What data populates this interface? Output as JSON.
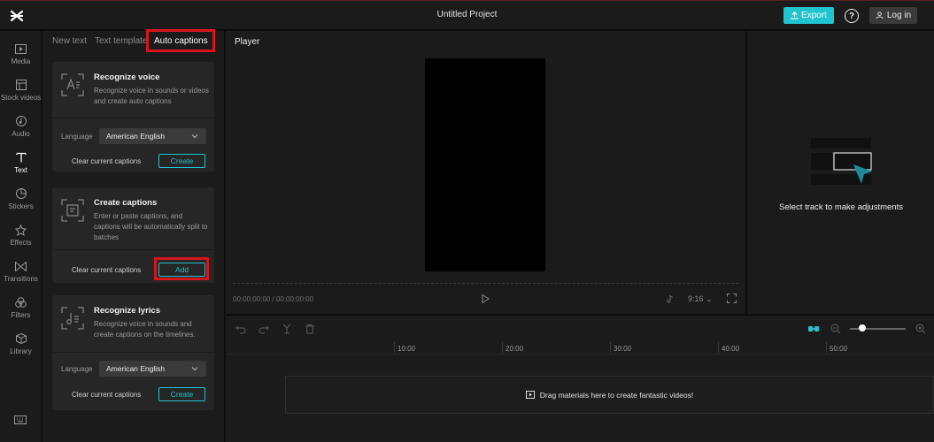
{
  "header": {
    "title": "Untitled Project",
    "export_label": "Export",
    "login_label": "Log in",
    "help_glyph": "?"
  },
  "sidebar": {
    "items": [
      {
        "label": "Media",
        "icon": "media-icon"
      },
      {
        "label": "Stock videos",
        "icon": "stock-videos-icon"
      },
      {
        "label": "Audio",
        "icon": "audio-icon"
      },
      {
        "label": "Text",
        "icon": "text-icon",
        "active": true
      },
      {
        "label": "Stickers",
        "icon": "stickers-icon"
      },
      {
        "label": "Effects",
        "icon": "effects-icon"
      },
      {
        "label": "Transitions",
        "icon": "transitions-icon"
      },
      {
        "label": "Filters",
        "icon": "filters-icon"
      },
      {
        "label": "Library",
        "icon": "library-icon"
      }
    ]
  },
  "text_panel": {
    "tabs": [
      "New text",
      "Text template",
      "Auto captions"
    ],
    "active_tab": "Auto captions",
    "recognize_voice": {
      "title": "Recognize voice",
      "description": "Recognize voice in sounds or videos and create auto captions",
      "language_label": "Language",
      "language_value": "American English",
      "clear_label": "Clear current captions",
      "button_label": "Create"
    },
    "create_captions": {
      "title": "Create captions",
      "description": "Enter or paste captions, and captions will be automatically split to batches",
      "clear_label": "Clear current captions",
      "button_label": "Add"
    },
    "recognize_lyrics": {
      "title": "Recognize lyrics",
      "description": "Recognize voice in sounds and create captions on the timelines.",
      "language_label": "Language",
      "language_value": "American English",
      "clear_label": "Clear current captions",
      "button_label": "Create"
    }
  },
  "player": {
    "title": "Player",
    "timecode": "00:00:00:00 / 00:00:00:00",
    "aspect_ratio": "9:16"
  },
  "details": {
    "empty_text": "Select track to make adjustments"
  },
  "timeline": {
    "ruler_labels": [
      "10:00",
      "20:00",
      "30:00",
      "40:00",
      "50:00"
    ],
    "drop_text": "Drag materials here to create fantastic videos!"
  },
  "colors": {
    "accent": "#21c3cf",
    "highlight": "#d8141c",
    "background": "#1b1b1b"
  }
}
